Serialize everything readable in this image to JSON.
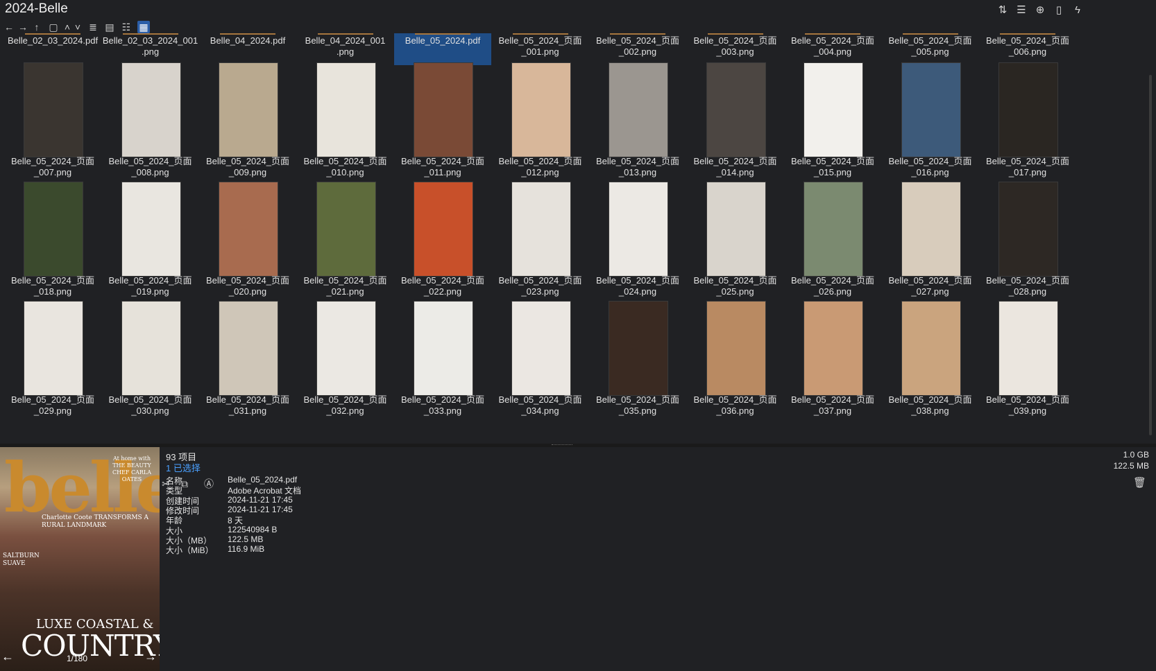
{
  "window": {
    "title": "2024-Belle"
  },
  "title_bar_icons": [
    "sort-icon",
    "details-view-icon",
    "add-icon",
    "clipboard-icon",
    "flash-icon"
  ],
  "toolbar": {
    "icons": [
      "back-icon",
      "forward-icon",
      "up-icon",
      "copy-path-icon",
      "chevron-up-icon",
      "chevron-down-icon",
      "list-view-icon",
      "tiles-view-icon",
      "tree-view-icon",
      "grid-view-icon"
    ],
    "active_view": "grid-view-icon"
  },
  "grid": {
    "top_row": [
      "Belle_02_03_2024.pdf",
      "Belle_02_03_2024_001\n.png",
      "Belle_04_2024.pdf",
      "Belle_04_2024_001\n.png",
      "Belle_05_2024.pdf",
      "Belle_05_2024_页面\n_001.png",
      "Belle_05_2024_页面\n_002.png",
      "Belle_05_2024_页面\n_003.png",
      "Belle_05_2024_页面\n_004.png",
      "Belle_05_2024_页面\n_005.png",
      "Belle_05_2024_页面\n_006.png"
    ],
    "selected_index": 4,
    "rows": [
      [
        "Belle_05_2024_页面\n_007.png",
        "Belle_05_2024_页面\n_008.png",
        "Belle_05_2024_页面\n_009.png",
        "Belle_05_2024_页面\n_010.png",
        "Belle_05_2024_页面\n_011.png",
        "Belle_05_2024_页面\n_012.png",
        "Belle_05_2024_页面\n_013.png",
        "Belle_05_2024_页面\n_014.png",
        "Belle_05_2024_页面\n_015.png",
        "Belle_05_2024_页面\n_016.png",
        "Belle_05_2024_页面\n_017.png"
      ],
      [
        "Belle_05_2024_页面\n_018.png",
        "Belle_05_2024_页面\n_019.png",
        "Belle_05_2024_页面\n_020.png",
        "Belle_05_2024_页面\n_021.png",
        "Belle_05_2024_页面\n_022.png",
        "Belle_05_2024_页面\n_023.png",
        "Belle_05_2024_页面\n_024.png",
        "Belle_05_2024_页面\n_025.png",
        "Belle_05_2024_页面\n_026.png",
        "Belle_05_2024_页面\n_027.png",
        "Belle_05_2024_页面\n_028.png"
      ],
      [
        "Belle_05_2024_页面\n_029.png",
        "Belle_05_2024_页面\n_030.png",
        "Belle_05_2024_页面\n_031.png",
        "Belle_05_2024_页面\n_032.png",
        "Belle_05_2024_页面\n_033.png",
        "Belle_05_2024_页面\n_034.png",
        "Belle_05_2024_页面\n_035.png",
        "Belle_05_2024_页面\n_036.png",
        "Belle_05_2024_页面\n_037.png",
        "Belle_05_2024_页面\n_038.png",
        "Belle_05_2024_页面\n_039.png"
      ]
    ],
    "thumb_colors": [
      [
        "#3a3530",
        "#d8d3cc",
        "#b9a98f",
        "#e8e4dc",
        "#7a4a36",
        "#d8b79a",
        "#9b9690",
        "#4c4642",
        "#f2f0ec",
        "#3d5a7a",
        "#2a2622"
      ],
      [
        "#3b4a2d",
        "#e9e6e0",
        "#a86b4f",
        "#5e6b3c",
        "#c8502a",
        "#e6e2dc",
        "#ece9e4",
        "#d9d4cc",
        "#7b8a70",
        "#d8ccbc",
        "#2d2824"
      ],
      [
        "#e9e5df",
        "#e6e2da",
        "#cfc6b8",
        "#ebe8e3",
        "#ecebe7",
        "#ebe7e2",
        "#3a2a22",
        "#b98a62",
        "#c99a74",
        "#caa47e",
        "#ebe6df"
      ]
    ]
  },
  "preview": {
    "brand": "belle",
    "tagline": "At home with THE BEAUTY CHEF CARLA OATES",
    "subtitle": "Charlotte Coote TRANSFORMS A RURAL LANDMARK",
    "side_text": "SALTBURN SUAVE",
    "luxe": "LUXE COASTAL &",
    "country": "COUNTRY",
    "counter": "1/180"
  },
  "info": {
    "item_count": "93 项目",
    "selected_count": "1 已选择",
    "total_size": "1.0 GB",
    "selected_size": "122.5 MB",
    "properties": [
      {
        "key": "名称",
        "value": "Belle_05_2024.pdf"
      },
      {
        "key": "类型",
        "value": "Adobe Acrobat 文档"
      },
      {
        "key": "创建时间",
        "value": "2024-11-21  17:45"
      },
      {
        "key": "修改时间",
        "value": "2024-11-21  17:45"
      },
      {
        "key": "年龄",
        "value": "8 天"
      },
      {
        "key": "大小",
        "value": "122540984 B"
      },
      {
        "key": "大小（MB）",
        "value": "122.5 MB"
      },
      {
        "key": "大小（MiB）",
        "value": "116.9 MiB"
      }
    ]
  }
}
